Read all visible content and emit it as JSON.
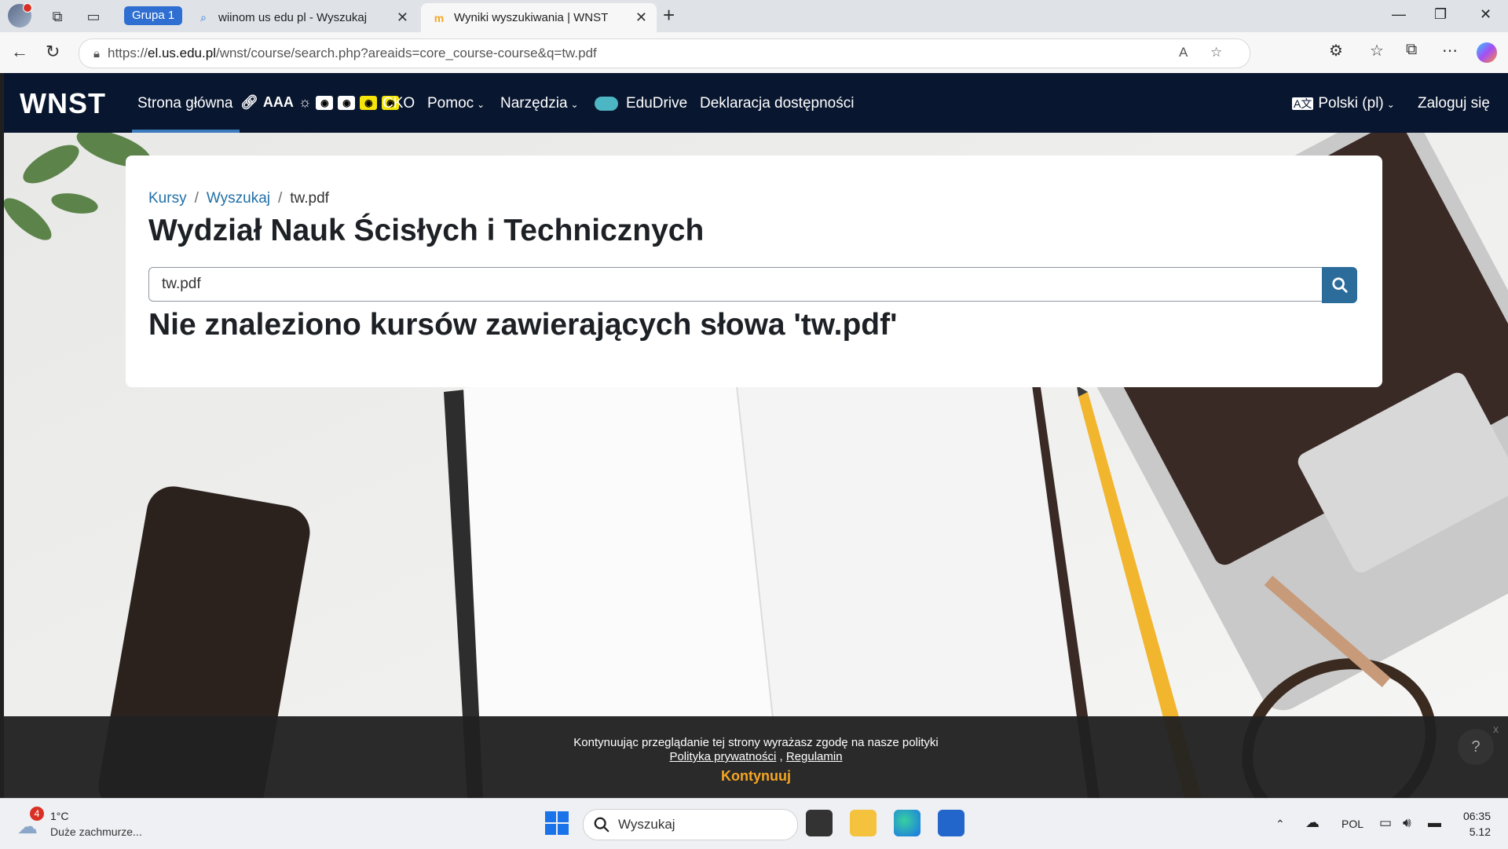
{
  "browser": {
    "group_label": "Grupa 1",
    "tabs": [
      {
        "title": "wiinom us edu pl - Wyszukaj",
        "active": false
      },
      {
        "title": "Wyniki wyszukiwania | WNST",
        "active": true
      }
    ],
    "url_prefix": "https://",
    "url_domain": "el.us.edu.pl",
    "url_path": "/wnst/course/search.php?areaids=core_course-course&q=tw.pdf"
  },
  "site": {
    "brand": "WNST",
    "nav": {
      "home": "Strona główna",
      "acc_text": "AAA",
      "cko": "CKO",
      "help": "Pomoc",
      "tools": "Narzędzia",
      "edudrive": "EduDrive",
      "accessibility": "Deklaracja dostępności",
      "language": "Polski (pl)",
      "login": "Zaloguj się"
    }
  },
  "content": {
    "breadcrumbs": [
      "Kursy",
      "Wyszukaj",
      "tw.pdf"
    ],
    "title": "Wydział Nauk Ścisłych i Technicznych",
    "search_value": "tw.pdf",
    "result_message": "Nie znaleziono kursów zawierających słowa 'tw.pdf'"
  },
  "cookie": {
    "text": "Kontynuując przeglądanie tej strony wyrażasz zgodę na nasze polityki",
    "privacy_link": "Polityka prywatności",
    "sep": " , ",
    "terms_link": "Regulamin",
    "cta": "Kontynuuj",
    "close": "x",
    "help": "?"
  },
  "taskbar": {
    "weather_badge": "4",
    "temperature": "1°C",
    "weather_desc": "Duże zachmurze...",
    "search_placeholder": "Wyszukaj",
    "language": "POL",
    "time": "06:35",
    "date": "5.12"
  },
  "colors": {
    "nav_bg": "#08162f",
    "accent_blue": "#2b6c9a",
    "link_blue": "#1f6fa6",
    "cookie_cta": "#f5a623"
  }
}
